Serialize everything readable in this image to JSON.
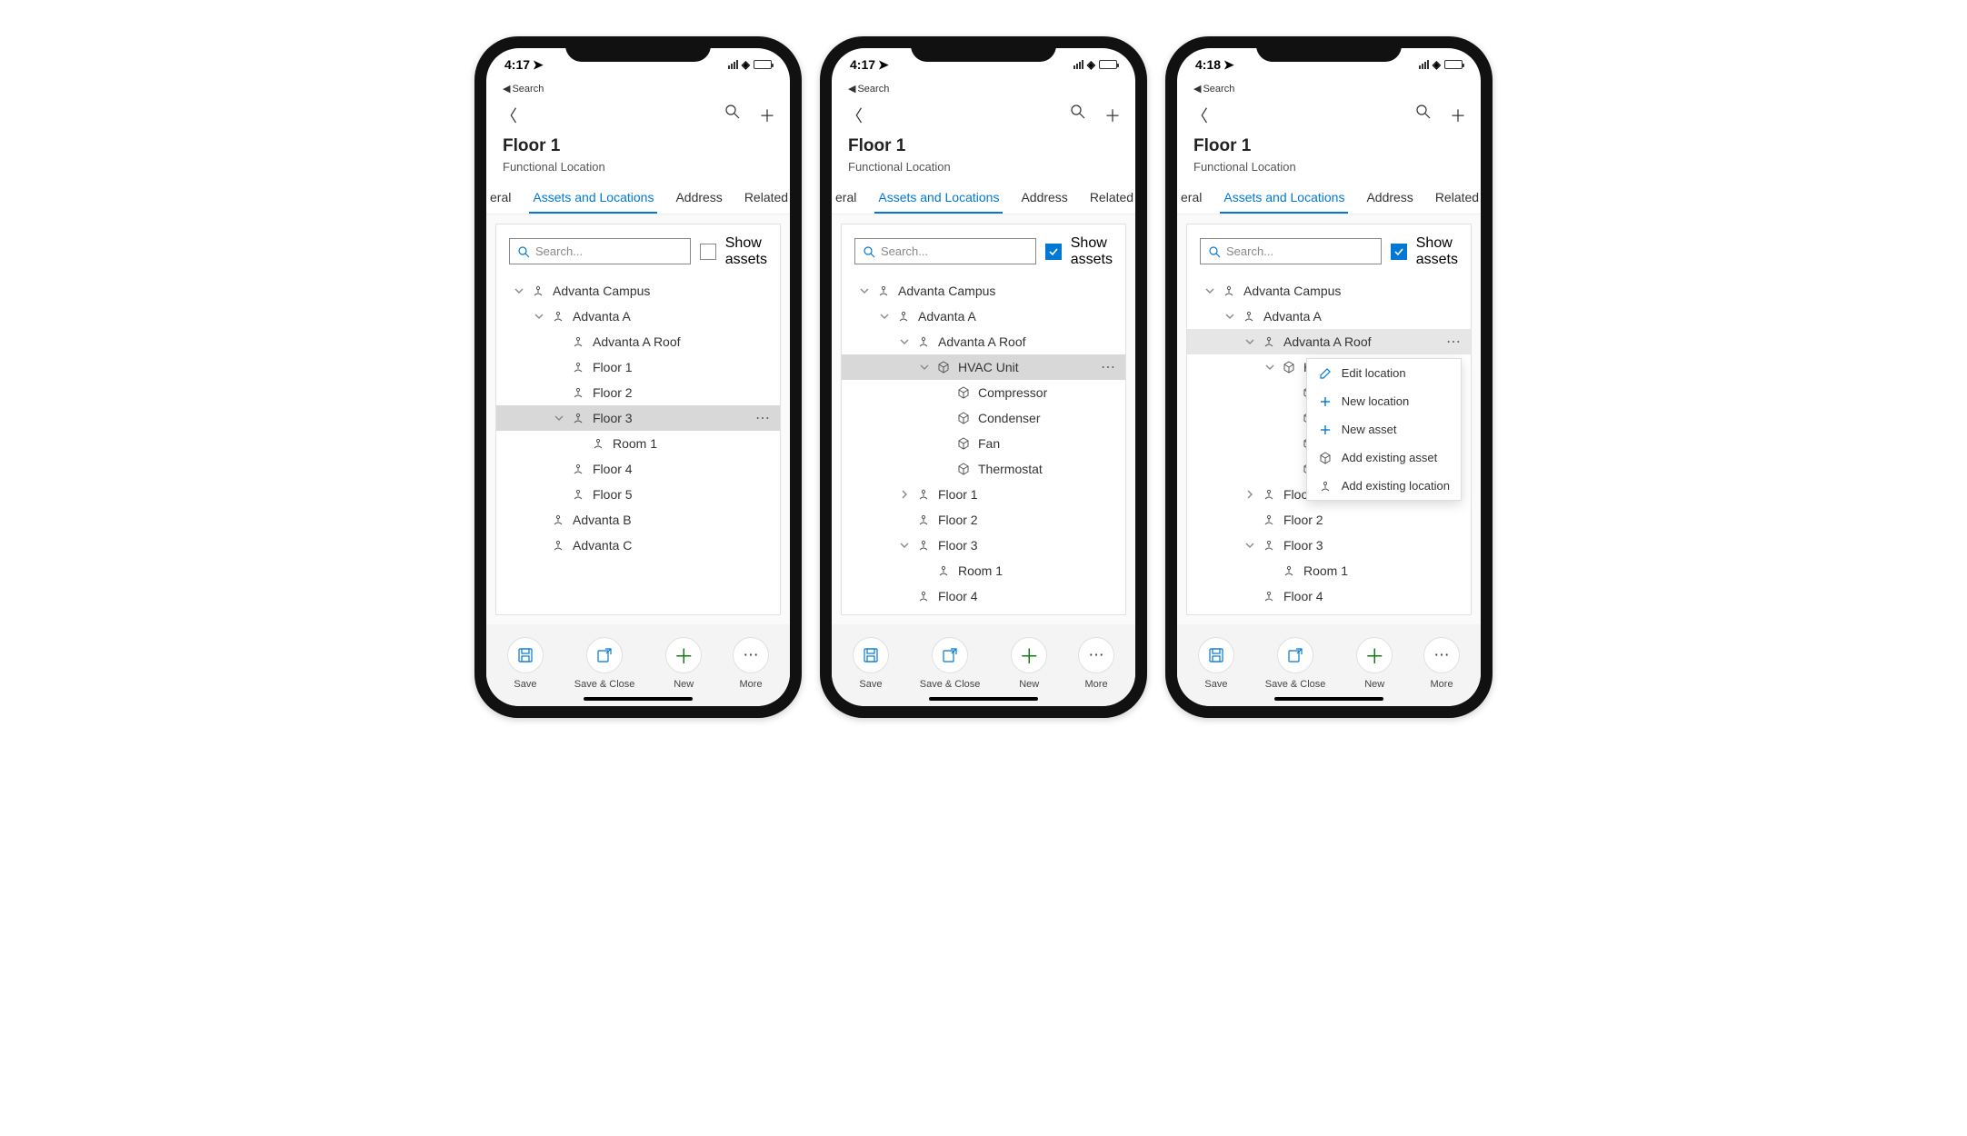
{
  "status": {
    "time1": "4:17",
    "time2": "4:17",
    "time3": "4:18",
    "back_label": "Search"
  },
  "header": {
    "title": "Floor 1",
    "subtitle": "Functional Location"
  },
  "tabs": {
    "partial_left": "eral",
    "active": "Assets and Locations",
    "third": "Address",
    "partial_right": "Related"
  },
  "search": {
    "placeholder": "Search..."
  },
  "show_assets": {
    "line1": "Show",
    "line2": "assets"
  },
  "tree1": [
    {
      "indent": 0,
      "exp": "down",
      "icon": "loc",
      "label": "Advanta Campus"
    },
    {
      "indent": 1,
      "exp": "down",
      "icon": "loc",
      "label": "Advanta A"
    },
    {
      "indent": 2,
      "exp": "",
      "icon": "loc",
      "label": "Advanta A Roof"
    },
    {
      "indent": 2,
      "exp": "",
      "icon": "loc",
      "label": "Floor 1"
    },
    {
      "indent": 2,
      "exp": "",
      "icon": "loc",
      "label": "Floor 2"
    },
    {
      "indent": 2,
      "exp": "down",
      "icon": "loc",
      "label": "Floor 3",
      "selected": true,
      "more": true
    },
    {
      "indent": 3,
      "exp": "",
      "icon": "loc",
      "label": "Room 1"
    },
    {
      "indent": 2,
      "exp": "",
      "icon": "loc",
      "label": "Floor 4"
    },
    {
      "indent": 2,
      "exp": "",
      "icon": "loc",
      "label": "Floor 5"
    },
    {
      "indent": 1,
      "exp": "",
      "icon": "loc",
      "label": "Advanta B"
    },
    {
      "indent": 1,
      "exp": "",
      "icon": "loc",
      "label": "Advanta C"
    }
  ],
  "tree2": [
    {
      "indent": 0,
      "exp": "down",
      "icon": "loc",
      "label": "Advanta Campus"
    },
    {
      "indent": 1,
      "exp": "down",
      "icon": "loc",
      "label": "Advanta A"
    },
    {
      "indent": 2,
      "exp": "down",
      "icon": "loc",
      "label": "Advanta A Roof"
    },
    {
      "indent": 3,
      "exp": "down",
      "icon": "asset",
      "label": "HVAC Unit",
      "selected": true,
      "more": true
    },
    {
      "indent": 4,
      "exp": "",
      "icon": "asset",
      "label": "Compressor"
    },
    {
      "indent": 4,
      "exp": "",
      "icon": "asset",
      "label": "Condenser"
    },
    {
      "indent": 4,
      "exp": "",
      "icon": "asset",
      "label": "Fan"
    },
    {
      "indent": 4,
      "exp": "",
      "icon": "asset",
      "label": "Thermostat"
    },
    {
      "indent": 2,
      "exp": "right",
      "icon": "loc",
      "label": "Floor 1"
    },
    {
      "indent": 2,
      "exp": "",
      "icon": "loc",
      "label": "Floor 2"
    },
    {
      "indent": 2,
      "exp": "down",
      "icon": "loc",
      "label": "Floor 3"
    },
    {
      "indent": 3,
      "exp": "",
      "icon": "loc",
      "label": "Room 1"
    },
    {
      "indent": 2,
      "exp": "",
      "icon": "loc",
      "label": "Floor 4"
    }
  ],
  "tree3": [
    {
      "indent": 0,
      "exp": "down",
      "icon": "loc",
      "label": "Advanta Campus"
    },
    {
      "indent": 1,
      "exp": "down",
      "icon": "loc",
      "label": "Advanta A"
    },
    {
      "indent": 2,
      "exp": "down",
      "icon": "loc",
      "label": "Advanta A Roof",
      "selected": "light",
      "more": true,
      "menu_anchor": true
    },
    {
      "indent": 3,
      "exp": "down",
      "icon": "asset",
      "label": "H"
    },
    {
      "indent": 4,
      "exp": "",
      "icon": "asset",
      "label": ""
    },
    {
      "indent": 4,
      "exp": "",
      "icon": "asset",
      "label": ""
    },
    {
      "indent": 4,
      "exp": "",
      "icon": "asset",
      "label": ""
    },
    {
      "indent": 4,
      "exp": "",
      "icon": "asset",
      "label": ""
    },
    {
      "indent": 2,
      "exp": "right",
      "icon": "loc",
      "label": "Floor 1"
    },
    {
      "indent": 2,
      "exp": "",
      "icon": "loc",
      "label": "Floor 2"
    },
    {
      "indent": 2,
      "exp": "down",
      "icon": "loc",
      "label": "Floor 3"
    },
    {
      "indent": 3,
      "exp": "",
      "icon": "loc",
      "label": "Room 1"
    },
    {
      "indent": 2,
      "exp": "",
      "icon": "loc",
      "label": "Floor 4"
    }
  ],
  "context_menu": [
    {
      "icon": "edit",
      "label": "Edit location"
    },
    {
      "icon": "plus",
      "label": "New location"
    },
    {
      "icon": "plus",
      "label": "New asset"
    },
    {
      "icon": "asset",
      "label": "Add existing asset"
    },
    {
      "icon": "loc",
      "label": "Add existing location"
    }
  ],
  "bottom": {
    "save": "Save",
    "save_close": "Save & Close",
    "new": "New",
    "more": "More"
  }
}
